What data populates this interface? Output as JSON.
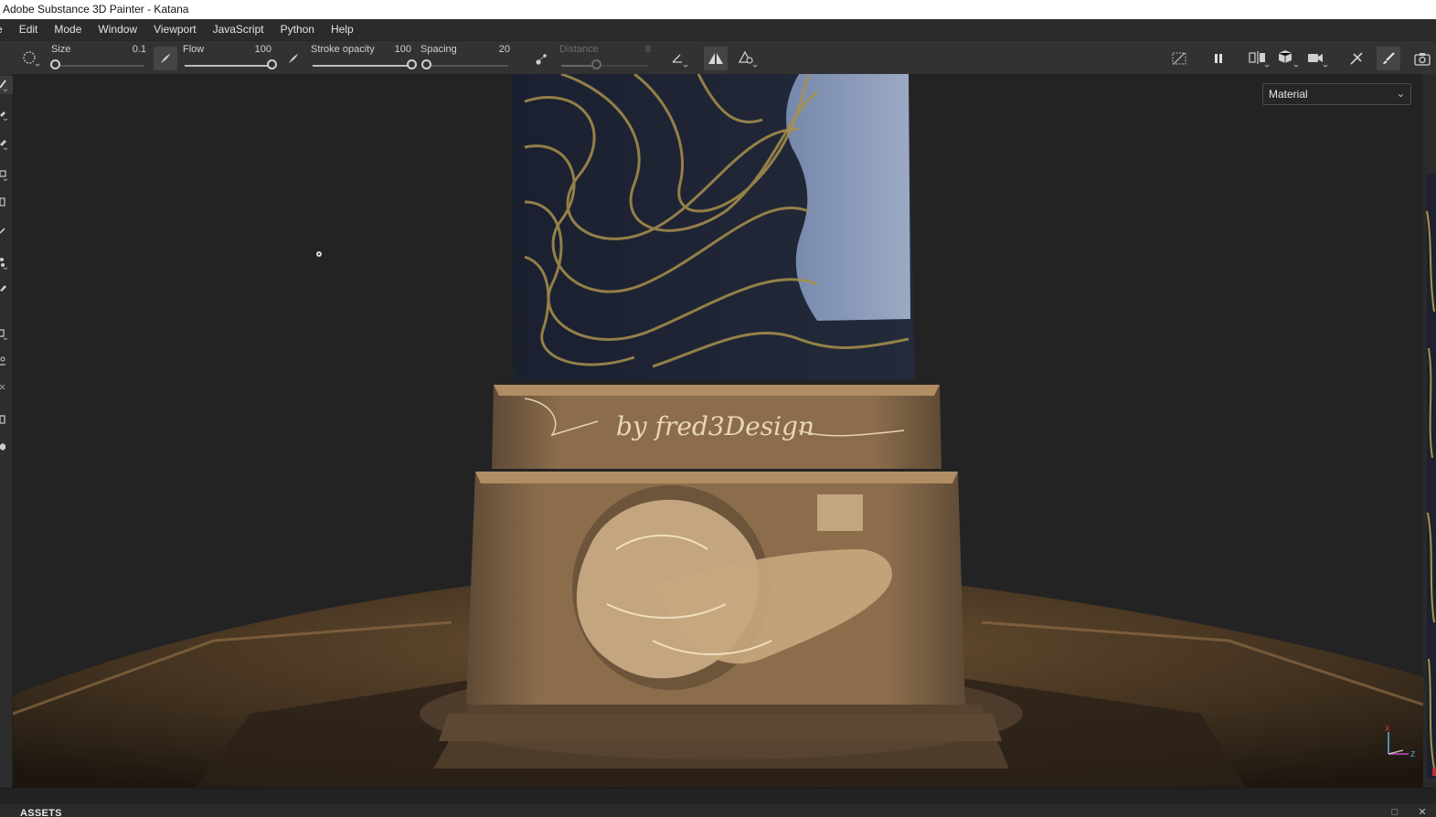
{
  "window": {
    "title": "Adobe Substance 3D Painter - Katana"
  },
  "menu": [
    "e",
    "Edit",
    "Mode",
    "Window",
    "Viewport",
    "JavaScript",
    "Python",
    "Help"
  ],
  "toolbar": {
    "size": {
      "label": "Size",
      "value": "0.1",
      "fraction": 0.02
    },
    "flow": {
      "label": "Flow",
      "value": "100",
      "fraction": 1.0
    },
    "stroke_opacity": {
      "label": "Stroke opacity",
      "value": "100",
      "fraction": 1.0
    },
    "spacing": {
      "label": "Spacing",
      "value": "20",
      "fraction": 0.05
    },
    "distance": {
      "label": "Distance",
      "value": "8",
      "fraction": 0.4
    }
  },
  "viewport": {
    "display_mode": "Material",
    "engraving_text": "by fred3Design",
    "axis": {
      "x": "X",
      "z": "Z"
    }
  },
  "assets_panel": {
    "title": "ASSETS"
  },
  "colors": {
    "titlebar": "#ffffff",
    "menubar": "#2b2b2b",
    "toolbar": "#323232",
    "viewport_bg": "#232323",
    "bronze": "#8a6a45",
    "gold_lines": "#b09a52",
    "blade_dark": "#1d2230"
  }
}
